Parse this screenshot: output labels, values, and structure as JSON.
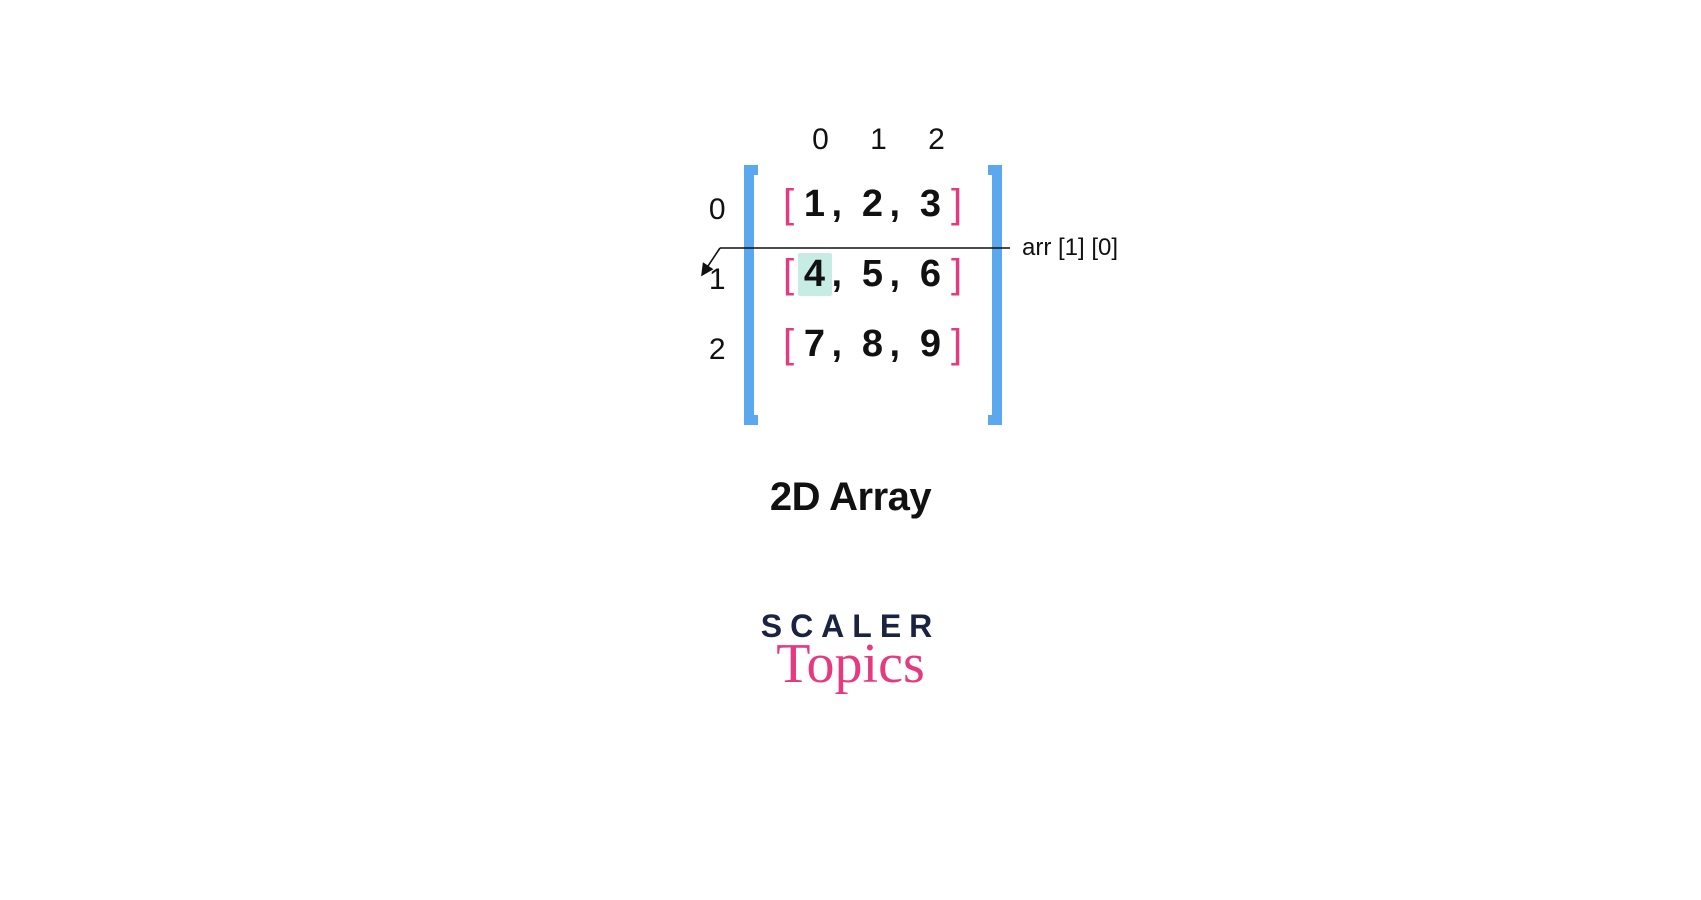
{
  "col_indices": [
    "0",
    "1",
    "2"
  ],
  "row_indices": [
    "0",
    "1",
    "2"
  ],
  "rows": [
    {
      "open": "[",
      "c0": "1",
      "s0": ",",
      "c1": "2",
      "s1": ",",
      "c2": "3",
      "close": "]"
    },
    {
      "open": "[",
      "c0": "4",
      "s0": ",",
      "c1": "5",
      "s1": ",",
      "c2": "6",
      "close": "]"
    },
    {
      "open": "[",
      "c0": "7",
      "s0": ",",
      "c1": "8",
      "s1": ",",
      "c2": "9",
      "close": "]"
    }
  ],
  "highlight": {
    "row": 1,
    "col": 0
  },
  "annotation_label": "arr [1] [0]",
  "caption": "2D Array",
  "logo": {
    "line1": "SCALER",
    "line2": "Topics"
  },
  "colors": {
    "outer_bracket": "#5ba8ef",
    "inner_bracket": "#e6397f",
    "highlight_bg": "#c6ece3",
    "text": "#111111",
    "logo_dark": "#1a2340",
    "logo_accent": "#e6397f"
  }
}
